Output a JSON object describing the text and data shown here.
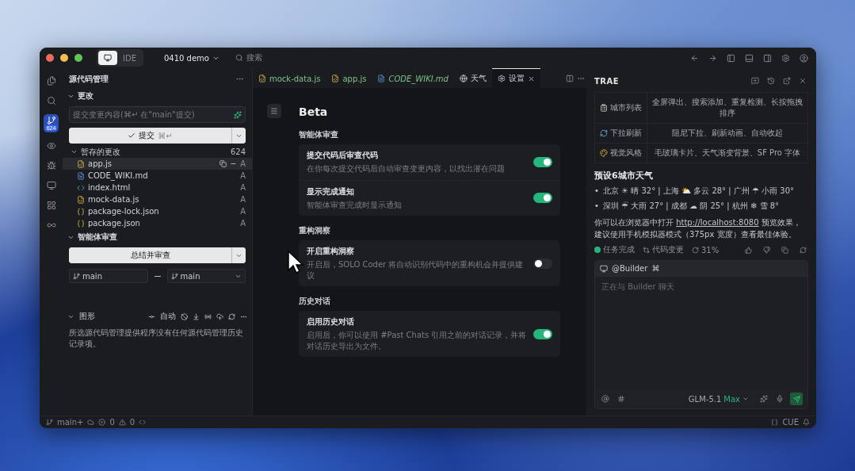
{
  "titlebar": {
    "modes": [
      {
        "kind": "solo",
        "selected": true
      },
      {
        "kind": "ide",
        "label": "IDE",
        "selected": false
      }
    ],
    "project": "0410 demo",
    "search": {
      "placeholder": "搜索"
    }
  },
  "activity_bar": [
    {
      "kind": "files",
      "selected": false
    },
    {
      "kind": "search",
      "selected": false
    },
    {
      "kind": "scm",
      "badge": "624",
      "selected": true
    },
    {
      "kind": "preview",
      "selected": false
    },
    {
      "kind": "debug",
      "selected": false
    },
    {
      "kind": "remote",
      "selected": false
    },
    {
      "kind": "extensions",
      "selected": false
    },
    {
      "kind": "more",
      "selected": false
    }
  ],
  "sidebar": {
    "title": "源代码管理",
    "changes": {
      "header": "更改",
      "commit_placeholder": "提交变更内容(⌘↵ 在\"main\"提交)",
      "commit_button": "提交",
      "commit_shortcut": "⌘↵",
      "staged": {
        "label": "暂存的更改",
        "count": "624",
        "files": [
          {
            "name": "app.js",
            "kind": "js",
            "status": "A",
            "selected": true
          },
          {
            "name": "CODE_WIKI.md",
            "kind": "md",
            "status": "A",
            "selected": false
          },
          {
            "name": "index.html",
            "kind": "html",
            "status": "A",
            "selected": false
          },
          {
            "name": "mock-data.js",
            "kind": "js",
            "status": "A",
            "selected": false
          },
          {
            "name": "package-lock.json",
            "kind": "json",
            "status": "A",
            "selected": false
          },
          {
            "name": "package.json",
            "kind": "json",
            "status": "A",
            "selected": false
          }
        ]
      }
    },
    "agent_review": {
      "header": "智能体审查",
      "button": "总结并审查",
      "base_branch": "main",
      "compare_branch": "main"
    },
    "graph": {
      "header": "图形",
      "auto": "自动",
      "message": "所选源代码管理提供程序没有任何源代码管理历史记录项。"
    }
  },
  "editor": {
    "tabs": [
      {
        "label": "mock-data.js",
        "kind": "js",
        "preview": false,
        "selected": false
      },
      {
        "label": "app.js",
        "kind": "js",
        "preview": false,
        "selected": false
      },
      {
        "label": "CODE_WIKI.md",
        "kind": "md",
        "preview": true,
        "selected": false
      },
      {
        "label": "天气",
        "kind": "web",
        "preview": false,
        "selected": false
      },
      {
        "label": "设置",
        "kind": "settings",
        "preview": false,
        "selected": true
      }
    ],
    "settings": {
      "title": "Beta",
      "sections": [
        {
          "heading": "智能体审查",
          "items": [
            {
              "title": "提交代码后审查代码",
              "description": "在你每次提交代码后自动审查变更内容，以找出潜在问题",
              "on": true
            },
            {
              "title": "显示完成通知",
              "description": "智能体审查完成时显示通知",
              "on": true
            }
          ]
        },
        {
          "heading": "重构洞察",
          "items": [
            {
              "title": "开启重构洞察",
              "description": "开启后，SOLO Coder 将自动识别代码中的重构机会并提供建议",
              "on": false
            }
          ]
        },
        {
          "heading": "历史对话",
          "items": [
            {
              "title": "启用历史对话",
              "description": "启用后，你可以使用 #Past Chats 引用之前的对话记录，并将对话历史导出为文件。",
              "on": true
            }
          ]
        }
      ]
    }
  },
  "assistant": {
    "title": "TRAE",
    "features": [
      {
        "kind": "list",
        "name": "城市列表",
        "description": "全屏弹出、搜索添加、重复检测、长按拖拽排序"
      },
      {
        "kind": "refresh",
        "name": "下拉刷新",
        "description": "阻尼下拉、刷新动画、自动收起"
      },
      {
        "kind": "style",
        "name": "视觉风格",
        "description": "毛玻璃卡片、天气渐变背景、SF Pro 字体"
      }
    ],
    "heading": "预设6城市天气",
    "weather": [
      {
        "marker": "•",
        "text": "北京 ☀ 晴 32° | 上海 ⛅ 多云 28° | 广州 ☂ 小雨 30°"
      },
      {
        "marker": "•",
        "text": "深圳 ☔ 大雨 27° | 成都 ☁ 阴 25° | 杭州 ❄ 雪 8°"
      }
    ],
    "note": {
      "before": "你可以在浏览器中打开 ",
      "link": "http://localhost:8080",
      "after": " 预览效果，建议使用手机模拟器模式（375px 宽度）查看最佳体验。"
    },
    "status": [
      {
        "kind": "done",
        "label": "任务完成"
      },
      {
        "kind": "changes",
        "label": "代码变更"
      },
      {
        "kind": "progress",
        "label": "31%"
      }
    ],
    "composer": {
      "agent": "@Builder",
      "agent_shortcut": "⌘",
      "placeholder": "正在与 Builder 聊天",
      "model": "GLM-5.1",
      "model_tier": "Max"
    }
  },
  "status_bar": {
    "branch": "main+",
    "errors": "0",
    "warnings": "0",
    "cue": "CUE"
  }
}
